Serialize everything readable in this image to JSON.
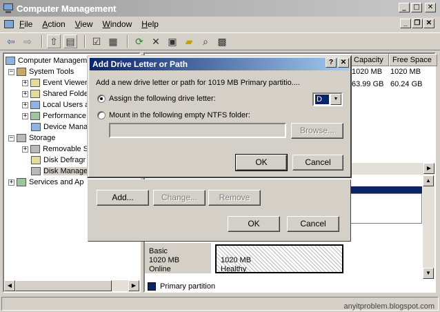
{
  "window": {
    "title": "Computer Management",
    "controls": {
      "minimize": "_",
      "maximize": "□",
      "close": "✕"
    }
  },
  "menu": {
    "items": [
      {
        "label": "File",
        "accel": "F",
        "rest": "ile"
      },
      {
        "label": "Action",
        "accel": "A",
        "rest": "ction"
      },
      {
        "label": "View",
        "accel": "V",
        "rest": "iew"
      },
      {
        "label": "Window",
        "accel": "W",
        "rest": "indow"
      },
      {
        "label": "Help",
        "accel": "H",
        "rest": "elp"
      }
    ],
    "mdi_controls": {
      "minimize": "_",
      "restore": "❐",
      "close": "✕"
    }
  },
  "toolbar": {
    "icons": [
      "back-arrow-icon",
      "forward-arrow-icon",
      "up-folder-icon",
      "show-hide-tree-icon",
      "properties-icon",
      "help-icon",
      "refresh-icon",
      "delete-icon",
      "properties2-icon",
      "open-icon",
      "search-icon",
      "settings-icon"
    ]
  },
  "tree": {
    "items": [
      {
        "label": "Computer Managem",
        "expander": "",
        "icon": "computer-icon"
      },
      {
        "label": "System Tools",
        "expander": "−",
        "icon": "system-tools-icon"
      },
      {
        "label": "Event Viewer",
        "expander": "+",
        "icon": "event-viewer-icon"
      },
      {
        "label": "Shared Folde",
        "expander": "+",
        "icon": "shared-folders-icon"
      },
      {
        "label": "Local Users a",
        "expander": "+",
        "icon": "users-icon"
      },
      {
        "label": "Performance",
        "expander": "+",
        "icon": "performance-icon"
      },
      {
        "label": "Device Mana",
        "expander": "",
        "icon": "device-manager-icon"
      },
      {
        "label": "Storage",
        "expander": "−",
        "icon": "storage-icon"
      },
      {
        "label": "Removable S",
        "expander": "+",
        "icon": "removable-storage-icon"
      },
      {
        "label": "Disk Defragr",
        "expander": "",
        "icon": "defrag-icon"
      },
      {
        "label": "Disk Manage",
        "expander": "",
        "icon": "disk-management-icon"
      },
      {
        "label": "Services and Ap",
        "expander": "+",
        "icon": "services-icon"
      }
    ]
  },
  "right_panel": {
    "columns": [
      "Capacity",
      "Free Space"
    ],
    "rows": [
      {
        "capacity": "1020 MB",
        "free": "1020 MB"
      },
      {
        "capacity": "63.99 GB",
        "free": "60.24 GB"
      }
    ],
    "disk_info": {
      "line0": "Basic",
      "line1": "1020 MB",
      "line2": "Online"
    },
    "partition": {
      "size": "1020 MB",
      "status": "Healthy"
    },
    "legend": "Primary partition"
  },
  "bg_dialog": {
    "add_label": "Add...",
    "change_label": "Change...",
    "remove_label": "Remove",
    "ok_label": "OK",
    "cancel_label": "Cancel"
  },
  "dialog": {
    "title": "Add Drive Letter or Path",
    "help_btn": "?",
    "close_btn": "✕",
    "description": "Add a new drive letter or path for 1019 MB  Primary partitio....",
    "option_assign": "Assign the following drive letter:",
    "option_mount": "Mount in the following empty NTFS folder:",
    "drive_letter": "D",
    "browse_label": "Browse...",
    "ok_label": "OK",
    "cancel_label": "Cancel"
  },
  "watermark": "anyitproblem.blogspot.com"
}
